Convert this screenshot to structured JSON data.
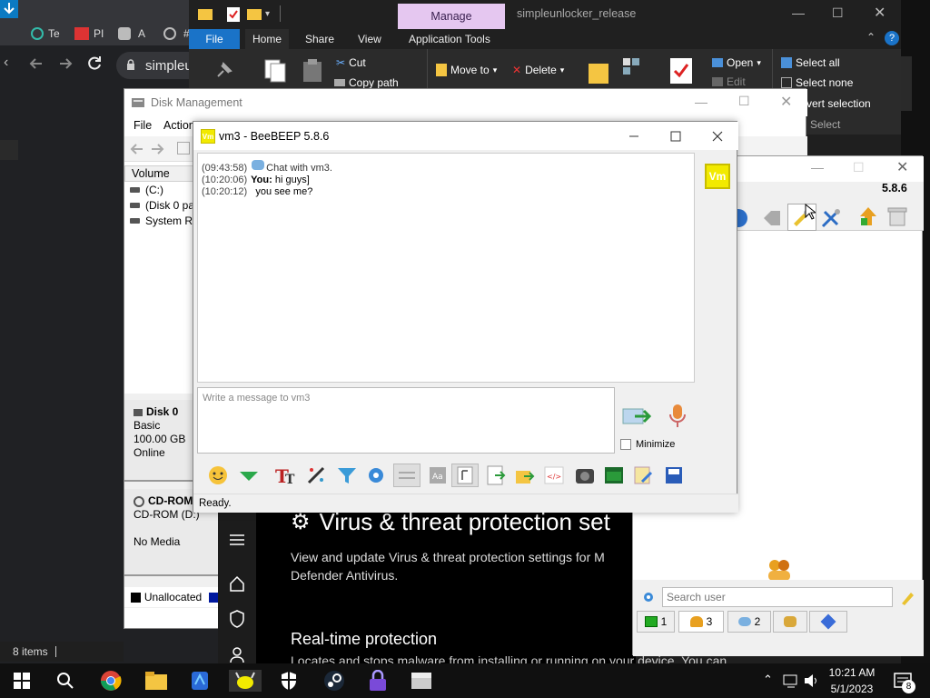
{
  "chrome": {
    "tabs": [
      {
        "label": "Te"
      },
      {
        "label": "PI"
      },
      {
        "label": "A"
      },
      {
        "label": "#"
      }
    ],
    "address": "simpleu"
  },
  "explorer": {
    "title": "simpleunlocker_release",
    "manage_label": "Manage",
    "ribbon_tabs": [
      "File",
      "Home",
      "Share",
      "View",
      "Application Tools"
    ],
    "cut": "Cut",
    "copy_path": "Copy path",
    "move_to": "Move to",
    "delete": "Delete",
    "open": "Open",
    "edit": "Edit",
    "select_all": "Select all",
    "select_none": "Select none",
    "invert_selection": "vert selection",
    "select_group": "Select",
    "status": "8 items"
  },
  "disk_management": {
    "title": "Disk Management",
    "menu": [
      "File",
      "Action"
    ],
    "volume_header": "Volume",
    "volumes": [
      "(C:)",
      "(Disk 0 par",
      "System Re"
    ],
    "disks": [
      {
        "name": "Disk 0",
        "type": "Basic",
        "size": "100.00 GB",
        "status": "Online"
      },
      {
        "name": "CD-ROM",
        "type": "CD-ROM (D:)",
        "size": "",
        "status": "No Media"
      }
    ],
    "legend": "Unallocated"
  },
  "windows_security": {
    "heading": "Virus & threat protection set",
    "description": "View and update Virus & threat protection settings for M Defender Antivirus.",
    "section": "Real-time protection",
    "section_text": "Locates and stops malware from installing or running on your device. You can turn off this setting for a short time before it turns back on"
  },
  "beebeep_main": {
    "version": "5.8.6",
    "search_placeholder": "Search user",
    "tabs": [
      {
        "count": "1",
        "icon": "chat-icon"
      },
      {
        "count": "3",
        "icon": "users-icon"
      },
      {
        "count": "2",
        "icon": "messages-icon"
      },
      {
        "count": "",
        "icon": "groups-icon"
      },
      {
        "count": "",
        "icon": "network-icon"
      }
    ]
  },
  "chat_window": {
    "title": "vm3 - BeeBEEP 5.8.6",
    "avatar_text": "Vm",
    "log": [
      {
        "time": "(09:43:58)",
        "sender": "",
        "text": "Chat with vm3."
      },
      {
        "time": "(10:20:06)",
        "sender": "You:",
        "text": " hi guys]"
      },
      {
        "time": "(10:20:12)",
        "sender": "",
        "text": "   you see me?"
      }
    ],
    "input_placeholder": "Write a message to vm3",
    "minimize_label": "Minimize",
    "status": "Ready."
  },
  "taskbar": {
    "time": "10:21 AM",
    "date": "5/1/2023",
    "notifications": "8"
  },
  "colors": {
    "beebeep_yellow": "#f2ea00",
    "manage_tab": "#e5c7f0",
    "file_tab": "#1a73c8",
    "taskbar": "#101010"
  }
}
